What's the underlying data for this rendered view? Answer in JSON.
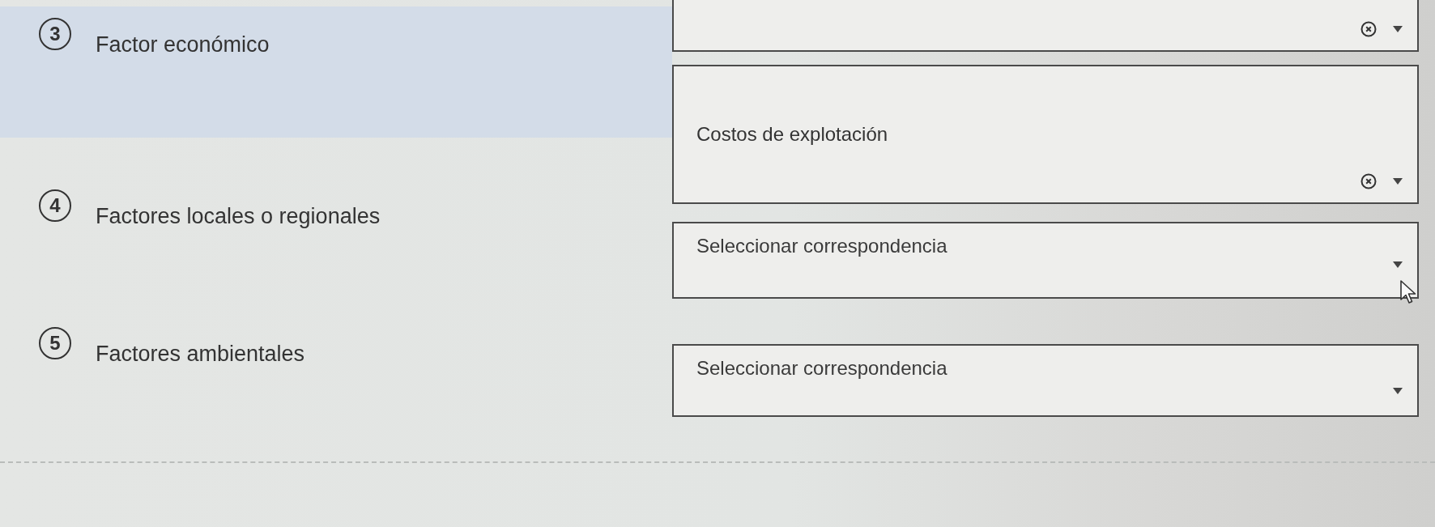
{
  "cut_off_select": {
    "clearable": true
  },
  "items": [
    {
      "number": "3",
      "prompt": "Factor económico",
      "highlighted": true,
      "select": {
        "value": "Costos de explotación",
        "clearable": true
      }
    },
    {
      "number": "4",
      "prompt": "Factores locales o regionales",
      "highlighted": false,
      "select": {
        "placeholder": "Seleccionar correspondencia",
        "clearable": false
      }
    },
    {
      "number": "5",
      "prompt": "Factores ambientales",
      "highlighted": false,
      "select": {
        "placeholder": "Seleccionar correspondencia",
        "clearable": false
      }
    }
  ]
}
